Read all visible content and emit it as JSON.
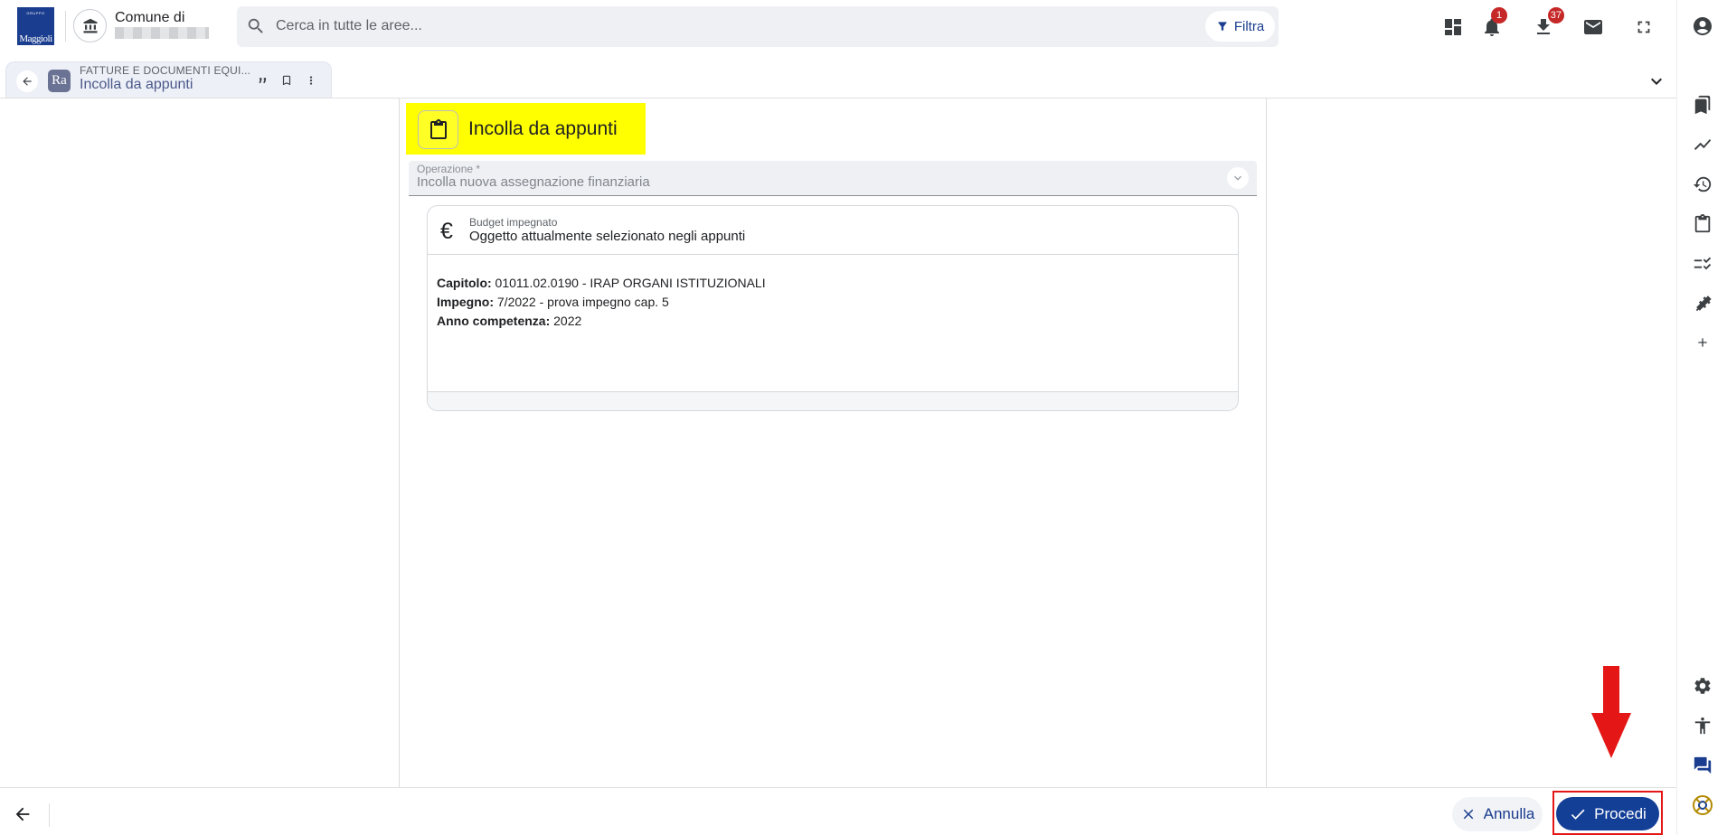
{
  "brand": {
    "logo_text": "Maggioli",
    "logo_small": "GRUPPO"
  },
  "header": {
    "ente_label": "Comune di",
    "search_placeholder": "Cerca in tutte le aree...",
    "filter_label": "Filtra",
    "notifications_badge": "1",
    "downloads_badge": "37"
  },
  "tab": {
    "section": "FATTURE E DOCUMENTI EQUI...",
    "title": "Incolla da appunti",
    "app_icon_text": "Ra"
  },
  "page": {
    "title": "Incolla da appunti",
    "operation_field": {
      "label": "Operazione *",
      "value": "Incolla nuova assegnazione finanziaria"
    },
    "card": {
      "label": "Budget impegnato",
      "subtitle": "Oggetto attualmente selezionato negli appunti",
      "euro_symbol": "€",
      "lines": [
        {
          "key": "Capitolo:",
          "value": " 01011.02.0190 - IRAP ORGANI ISTITUZIONALI"
        },
        {
          "key": "Impegno:",
          "value": " 7/2022 - prova impegno cap. 5"
        },
        {
          "key": "Anno competenza:",
          "value": " 2022"
        }
      ]
    }
  },
  "footer": {
    "cancel_label": "Annulla",
    "proceed_label": "Procedi"
  },
  "colors": {
    "primary": "#143f97",
    "highlight": "#ffff00",
    "annotation": "#e51616",
    "badge": "#c62828"
  }
}
